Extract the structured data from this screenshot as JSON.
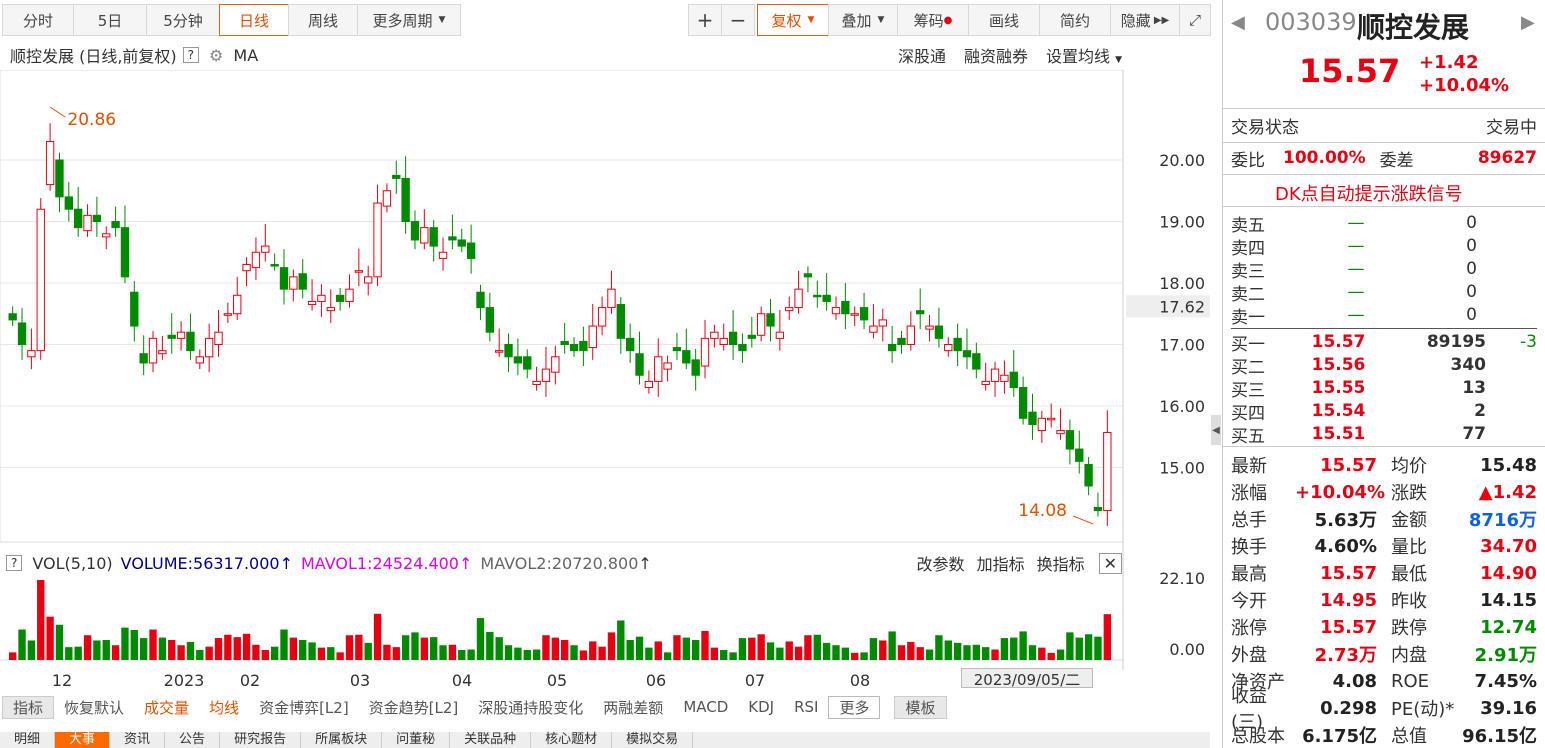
{
  "toolbar": {
    "left": [
      "分时",
      "5日",
      "5分钟",
      "日线",
      "周线",
      "更多周期"
    ],
    "right": [
      "+",
      "−",
      "复权",
      "叠加",
      "筹码",
      "画线",
      "简约",
      "隐藏"
    ],
    "active": "日线"
  },
  "chart_header": {
    "title": "顺控发展 (日线,前复权)",
    "help": "?",
    "ma": "MA",
    "links": [
      "深股通",
      "融资融券",
      "设置均线"
    ]
  },
  "chart_data": {
    "type": "candlestick",
    "y_ticks": [
      "20.00",
      "19.00",
      "18.00",
      "17.00",
      "16.00",
      "15.00"
    ],
    "current_label": "17.62",
    "high_label": "20.86",
    "low_label": "14.08",
    "x_labels": [
      "12",
      "2023",
      "02",
      "03",
      "04",
      "05",
      "06",
      "07",
      "08"
    ],
    "date_cursor": "2023/09/05/二",
    "vol": {
      "legend": "VOL(5,10)",
      "volume": "VOLUME:56317.000",
      "mavol1": "MAVOL1:24524.400",
      "mavol2": "MAVOL2:20720.800",
      "actions": [
        "改参数",
        "加指标",
        "换指标"
      ],
      "y_ticks": [
        "22.10",
        "0.00"
      ]
    },
    "closes": [
      17.4,
      17.0,
      16.9,
      19.2,
      20.3,
      19.4,
      19.2,
      18.9,
      19.1,
      19.0,
      18.8,
      18.9,
      18.1,
      17.3,
      16.7,
      17.1,
      16.9,
      17.1,
      17.2,
      16.9,
      16.8,
      17.1,
      17.2,
      17.5,
      17.8,
      18.3,
      18.5,
      18.6,
      18.3,
      17.9,
      18.1,
      17.9,
      17.7,
      17.8,
      17.6,
      17.7,
      17.9,
      18.2,
      18.1,
      19.3,
      19.5,
      19.7,
      19.0,
      18.7,
      18.9,
      18.6,
      18.5,
      18.7,
      18.6,
      18.4,
      17.6,
      17.2,
      16.9,
      16.8,
      16.7,
      16.6,
      16.4,
      16.6,
      16.8,
      17.0,
      16.9,
      16.9,
      17.3,
      17.6,
      17.9,
      17.1,
      16.9,
      16.5,
      16.4,
      16.8,
      16.7,
      16.9,
      16.7,
      16.5,
      17.1,
      17.2,
      17.1,
      17.0,
      16.9,
      17.1,
      17.5,
      17.3,
      17.2,
      17.6,
      17.9,
      18.1,
      17.8,
      17.7,
      17.6,
      17.5,
      17.5,
      17.4,
      17.3,
      17.4,
      16.9,
      17.0,
      17.3,
      17.5,
      17.3,
      17.1,
      17.0,
      16.9,
      16.8,
      16.6,
      16.4,
      16.6,
      16.5,
      16.3,
      15.8,
      15.7,
      15.8,
      15.8,
      15.6,
      15.3,
      15.1,
      14.7,
      14.3,
      15.57
    ]
  },
  "right": {
    "code": "003039",
    "name": "顺控发展",
    "price": "15.57",
    "change": "+1.42",
    "pct": "+10.04%",
    "status_label": "交易状态",
    "status": "交易中",
    "wb_label": "委比",
    "wb": "100.00%",
    "wc_label": "委差",
    "wc": "89627",
    "dk": "DK点自动提示涨跌信号",
    "sell": [
      [
        "卖五",
        "—",
        "0"
      ],
      [
        "卖四",
        "—",
        "0"
      ],
      [
        "卖三",
        "—",
        "0"
      ],
      [
        "卖二",
        "—",
        "0"
      ],
      [
        "卖一",
        "—",
        "0"
      ]
    ],
    "buy": [
      [
        "买一",
        "15.57",
        "89195",
        "-3"
      ],
      [
        "买二",
        "15.56",
        "340",
        ""
      ],
      [
        "买三",
        "15.55",
        "13",
        ""
      ],
      [
        "买四",
        "15.54",
        "2",
        ""
      ],
      [
        "买五",
        "15.51",
        "77",
        ""
      ]
    ],
    "stats": [
      [
        "最新",
        "15.57",
        "均价",
        "15.48"
      ],
      [
        "涨幅",
        "+10.04%",
        "涨跌",
        "▲1.42"
      ],
      [
        "总手",
        "5.63万",
        "金额",
        "8716万"
      ],
      [
        "换手",
        "4.60%",
        "量比",
        "34.70"
      ],
      [
        "最高",
        "15.57",
        "最低",
        "14.90"
      ],
      [
        "今开",
        "14.95",
        "昨收",
        "14.15"
      ],
      [
        "涨停",
        "15.57",
        "跌停",
        "12.74"
      ],
      [
        "外盘",
        "2.73万",
        "内盘",
        "2.91万"
      ],
      [
        "净资产",
        "4.08",
        "ROE",
        "7.45%"
      ],
      [
        "收益(三)",
        "0.298",
        "PE(动)*",
        "39.16"
      ],
      [
        "总股本",
        "6.175亿",
        "总值",
        "96.15亿"
      ]
    ]
  },
  "bottom": {
    "tabs": [
      "指标",
      "恢复默认",
      "成交量",
      "均线",
      "资金博弈[L2]",
      "资金趋势[L2]",
      "深股通持股变化",
      "两融差额",
      "MACD",
      "KDJ",
      "RSI",
      "更多",
      "模板"
    ],
    "last": [
      "明细",
      "大事",
      "资讯",
      "公告",
      "研究报告",
      "所属板块",
      "问董秘",
      "关联品种",
      "核心题材",
      "模拟交易"
    ]
  }
}
